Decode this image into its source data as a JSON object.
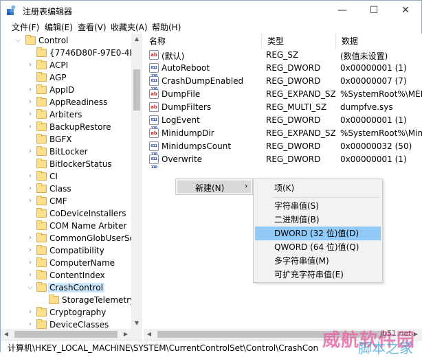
{
  "window": {
    "title": "注册表编辑器",
    "min_label": "—",
    "max_label": "☐",
    "close_label": "✕"
  },
  "menu": [
    "文件(F)",
    "编辑(E)",
    "查看(V)",
    "收藏夹(A)",
    "帮助(H)"
  ],
  "tree": {
    "items": [
      {
        "label": "Control",
        "expanded": true
      },
      {
        "label": "{7746D80F-97E0-4E26-"
      },
      {
        "label": "ACPI"
      },
      {
        "label": "AGP"
      },
      {
        "label": "AppID"
      },
      {
        "label": "AppReadiness"
      },
      {
        "label": "Arbiters"
      },
      {
        "label": "BackupRestore"
      },
      {
        "label": "BGFX"
      },
      {
        "label": "BitLocker"
      },
      {
        "label": "BitlockerStatus"
      },
      {
        "label": "CI"
      },
      {
        "label": "Class"
      },
      {
        "label": "CMF"
      },
      {
        "label": "CoDeviceInstallers"
      },
      {
        "label": "COM Name Arbiter"
      },
      {
        "label": "CommonGlobUserSett"
      },
      {
        "label": "Compatibility"
      },
      {
        "label": "ComputerName"
      },
      {
        "label": "ContentIndex"
      },
      {
        "label": "CrashControl",
        "selected": true
      },
      {
        "label": "StorageTelemetry"
      },
      {
        "label": "Cryptography"
      },
      {
        "label": "DeviceClasses"
      }
    ]
  },
  "list": {
    "headers": {
      "name": "名称",
      "type": "类型",
      "data": "数据"
    },
    "rows": [
      {
        "icon": "ab",
        "name": "(默认)",
        "type": "REG_SZ",
        "data": "(数值未设置)"
      },
      {
        "icon": "bin",
        "name": "AutoReboot",
        "type": "REG_DWORD",
        "data": "0x00000001 (1)"
      },
      {
        "icon": "bin",
        "name": "CrashDumpEnabled",
        "type": "REG_DWORD",
        "data": "0x00000007 (7)"
      },
      {
        "icon": "ab",
        "name": "DumpFile",
        "type": "REG_EXPAND_SZ",
        "data": "%SystemRoot%\\MEM"
      },
      {
        "icon": "ab",
        "name": "DumpFilters",
        "type": "REG_MULTI_SZ",
        "data": "dumpfve.sys"
      },
      {
        "icon": "bin",
        "name": "LogEvent",
        "type": "REG_DWORD",
        "data": "0x00000001 (1)"
      },
      {
        "icon": "ab",
        "name": "MinidumpDir",
        "type": "REG_EXPAND_SZ",
        "data": "%SystemRoot%\\Minic"
      },
      {
        "icon": "bin",
        "name": "MinidumpsCount",
        "type": "REG_DWORD",
        "data": "0x00000032 (50)"
      },
      {
        "icon": "bin",
        "name": "Overwrite",
        "type": "REG_DWORD",
        "data": "0x00000001 (1)"
      }
    ]
  },
  "context_menu": {
    "new_label": "新建(N)",
    "submenu_arrow": "›",
    "submenu": [
      {
        "label": "项(K)"
      },
      {
        "label": "字符串值(S)"
      },
      {
        "label": "二进制值(B)"
      },
      {
        "label": "DWORD (32 位)值(D)",
        "active": true
      },
      {
        "label": "QWORD (64 位)值(Q)"
      },
      {
        "label": "多字符串值(M)"
      },
      {
        "label": "可扩充字符串值(E)"
      }
    ]
  },
  "status": {
    "path": "计算机\\HKEY_LOCAL_MACHINE\\SYSTEM\\CurrentControlSet\\Control\\CrashCon"
  },
  "watermark": {
    "line1": "威航软件园",
    "line2": "jb51.net",
    "line3": "脚本之家"
  },
  "colors": {
    "selection": "#cce8ff",
    "menu_highlight": "#91c9f7",
    "folder": "#ffe08a"
  }
}
